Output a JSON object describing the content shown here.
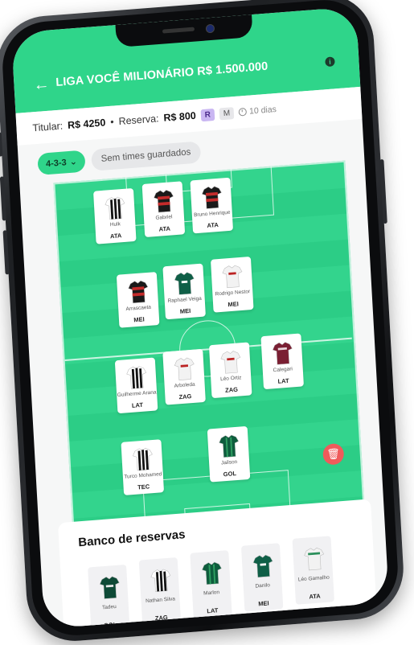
{
  "header": {
    "title": "LIGA VOCÊ MILIONÁRIO R$ 1.500.000",
    "back_icon": "arrow-left-icon",
    "info_icon": "info-icon",
    "info_glyph": "i"
  },
  "budget": {
    "titular_label": "Titular:",
    "titular_value": "R$ 4250",
    "separator": "•",
    "reserva_label": "Reserva:",
    "reserva_value": "R$ 800",
    "badge_r": "R",
    "badge_m": "M",
    "days": "10 dias"
  },
  "filters": {
    "formation": "4-3-3",
    "saved": "Sem times guardados"
  },
  "colors": {
    "accent": "#2fd58a",
    "pitch": "#33d48d",
    "danger": "#ef5b5b",
    "badge_r_bg": "#c9b6f2"
  },
  "lineup": [
    {
      "name": "Hulk",
      "pos": "ATA",
      "shirt": "stripes-bw"
    },
    {
      "name": "Gabriel",
      "pos": "ATA",
      "shirt": "red-black"
    },
    {
      "name": "Bruno Henrique",
      "pos": "ATA",
      "shirt": "red-black"
    },
    {
      "name": "Arrascaeta",
      "pos": "MEI",
      "shirt": "red-black"
    },
    {
      "name": "Raphael Veiga",
      "pos": "MEI",
      "shirt": "green"
    },
    {
      "name": "Rodrigo Nestor",
      "pos": "MEI",
      "shirt": "white"
    },
    {
      "name": "Guilherme Arana",
      "pos": "LAT",
      "shirt": "stripes-bw"
    },
    {
      "name": "Arboleda",
      "pos": "ZAG",
      "shirt": "white"
    },
    {
      "name": "Léo Ortiz",
      "pos": "ZAG",
      "shirt": "white"
    },
    {
      "name": "Calegari",
      "pos": "LAT",
      "shirt": "maroon"
    },
    {
      "name": "Turco Mohamed",
      "pos": "TEC",
      "shirt": "stripes-bw"
    },
    {
      "name": "Jailson",
      "pos": "GOL",
      "shirt": "green-stripes"
    }
  ],
  "bench": {
    "title": "Banco de reservas",
    "players": [
      {
        "name": "Tadeu",
        "pos": "GOL",
        "shirt": "green-dark"
      },
      {
        "name": "Nathan Silva",
        "pos": "ZAG",
        "shirt": "stripes-bw"
      },
      {
        "name": "Marlon",
        "pos": "LAT",
        "shirt": "green-stripes"
      },
      {
        "name": "Danilo",
        "pos": "MEI",
        "shirt": "green"
      },
      {
        "name": "Léo Gamalho",
        "pos": "ATA",
        "shirt": "white-green"
      }
    ]
  },
  "trash_icon": "trash-icon",
  "trash_glyph": "🗑"
}
